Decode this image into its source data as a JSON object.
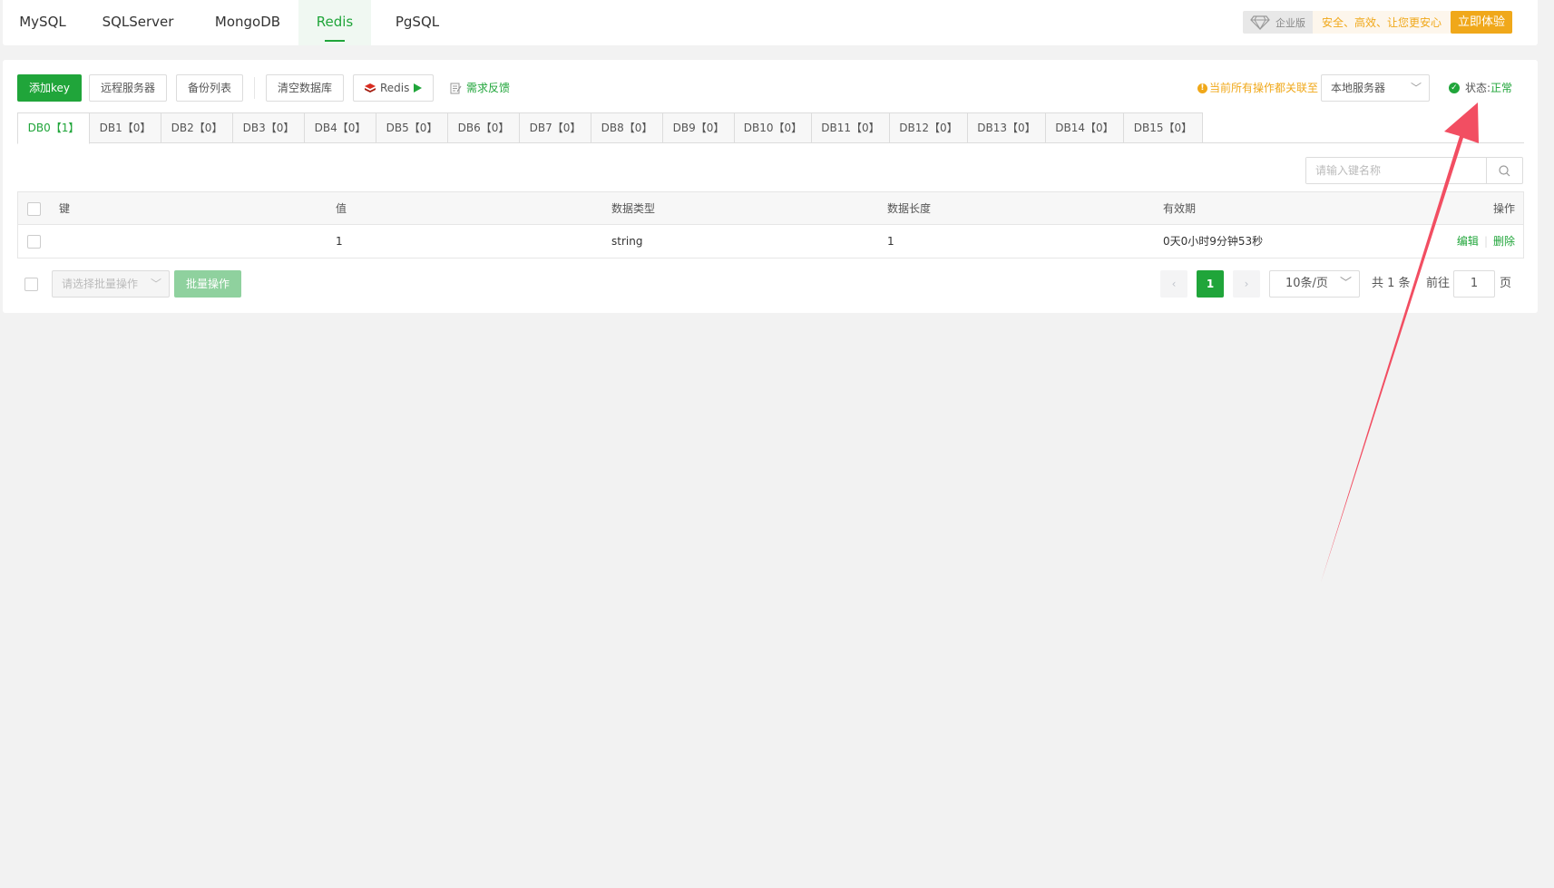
{
  "db_type_tabs": [
    "MySQL",
    "SQLServer",
    "MongoDB",
    "Redis",
    "PgSQL"
  ],
  "active_db_type": "Redis",
  "promo": {
    "badge": "企业版",
    "text": "安全、高效、让您更安心",
    "button": "立即体验"
  },
  "toolbar": {
    "add_key": "添加key",
    "remote_server": "远程服务器",
    "backup_list": "备份列表",
    "clear_db": "清空数据库",
    "redis_btn": "Redis",
    "feedback": "需求反馈"
  },
  "notice": "当前所有操作都关联至",
  "server_select": "本地服务器",
  "status": {
    "label": "状态:",
    "value": "正常"
  },
  "db_tabs": [
    "DB0【1】",
    "DB1【0】",
    "DB2【0】",
    "DB3【0】",
    "DB4【0】",
    "DB5【0】",
    "DB6【0】",
    "DB7【0】",
    "DB8【0】",
    "DB9【0】",
    "DB10【0】",
    "DB11【0】",
    "DB12【0】",
    "DB13【0】",
    "DB14【0】",
    "DB15【0】"
  ],
  "search": {
    "placeholder": "请输入键名称"
  },
  "table": {
    "columns": [
      "键",
      "值",
      "数据类型",
      "数据长度",
      "有效期",
      "操作"
    ],
    "rows": [
      {
        "key": "",
        "value": "1",
        "type": "string",
        "length": "1",
        "ttl": "0天0小时9分钟53秒",
        "edit": "编辑",
        "delete": "删除"
      }
    ]
  },
  "batch": {
    "select_placeholder": "请选择批量操作",
    "button": "批量操作"
  },
  "pagination": {
    "current_page": "1",
    "page_size": "10条/页",
    "total_prefix": "共 1 条",
    "goto_label": "前往",
    "goto_value": "1",
    "page_suffix": "页"
  },
  "colors": {
    "primary": "#20a53a",
    "warning": "#f0a81a",
    "annotation_arrow": "#f24e62"
  }
}
